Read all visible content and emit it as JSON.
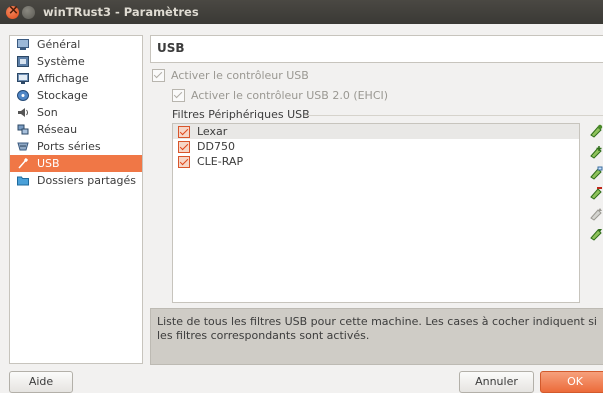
{
  "window": {
    "title": "winTRust3 - Paramètres"
  },
  "sidebar": {
    "items": [
      {
        "label": "Général",
        "icon": "general-icon"
      },
      {
        "label": "Système",
        "icon": "system-chip-icon"
      },
      {
        "label": "Affichage",
        "icon": "display-monitor-icon"
      },
      {
        "label": "Stockage",
        "icon": "storage-disk-icon"
      },
      {
        "label": "Son",
        "icon": "speaker-icon"
      },
      {
        "label": "Réseau",
        "icon": "network-icon"
      },
      {
        "label": "Ports séries",
        "icon": "serial-port-icon"
      },
      {
        "label": "USB",
        "icon": "usb-plug-icon",
        "selected": true
      },
      {
        "label": "Dossiers partagés",
        "icon": "shared-folder-icon"
      }
    ]
  },
  "usb": {
    "header": "USB",
    "enable_controller": "Activer le contrôleur USB",
    "enable_ehci": "Activer le contrôleur USB 2.0 (EHCI)",
    "filters_label": "Filtres Périphériques USB",
    "filters": [
      {
        "name": "Lexar",
        "checked": true
      },
      {
        "name": "DD750",
        "checked": true
      },
      {
        "name": "CLE-RAP",
        "checked": true
      }
    ],
    "tools": [
      "add-filter-icon",
      "add-from-device-icon",
      "edit-filter-icon",
      "remove-filter-icon",
      "move-up-icon",
      "move-down-icon"
    ]
  },
  "description": "Liste de tous les filtres USB pour cette machine. Les cases à cocher indiquent si les filtres correspondants sont activés.",
  "buttons": {
    "help": "Aide",
    "cancel": "Annuler",
    "ok": "OK"
  },
  "colors": {
    "accent": "#f07746",
    "titlebar": "#3c3b37"
  }
}
